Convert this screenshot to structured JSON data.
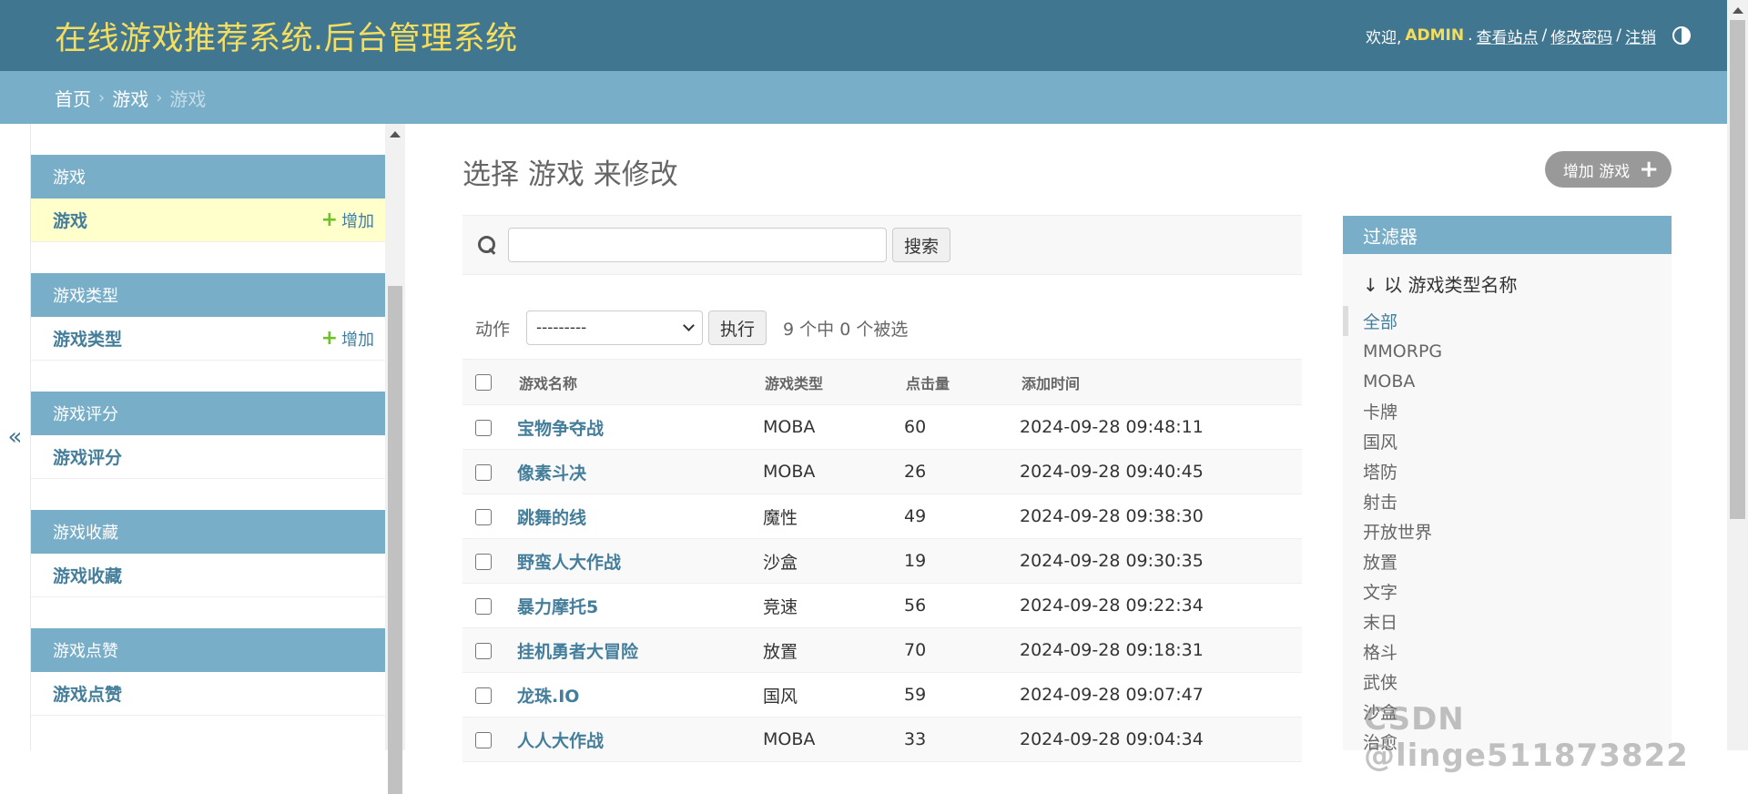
{
  "header": {
    "site_title": "在线游戏推荐系统.后台管理系统",
    "welcome": "欢迎,",
    "username": "ADMIN",
    "dot": ".",
    "view_site": "查看站点",
    "change_password": "修改密码",
    "logout": "注销",
    "slash": "/"
  },
  "breadcrumbs": {
    "home": "首页",
    "app": "游戏",
    "current": "游戏",
    "sep": "›"
  },
  "nav_toggle": "«",
  "sidebar": {
    "add_label": "增加",
    "groups": [
      {
        "caption": "游戏",
        "model": "游戏",
        "addable": true,
        "current": true
      },
      {
        "caption": "游戏类型",
        "model": "游戏类型",
        "addable": true
      },
      {
        "caption": "游戏评分",
        "model": "游戏评分"
      },
      {
        "caption": "游戏收藏",
        "model": "游戏收藏"
      },
      {
        "caption": "游戏点赞",
        "model": "游戏点赞"
      }
    ]
  },
  "content": {
    "title": "选择 游戏 来修改",
    "add_button": "增加 游戏",
    "search_button": "搜索",
    "search_value": "",
    "action_label": "动作",
    "action_selected": "---------",
    "go_button": "执行",
    "counter": "9 个中 0 个被选"
  },
  "table": {
    "columns": [
      "游戏名称",
      "游戏类型",
      "点击量",
      "添加时间"
    ],
    "rows": [
      [
        "宝物争夺战",
        "MOBA",
        "60",
        "2024-09-28 09:48:11"
      ],
      [
        "像素斗决",
        "MOBA",
        "26",
        "2024-09-28 09:40:45"
      ],
      [
        "跳舞的线",
        "魔性",
        "49",
        "2024-09-28 09:38:30"
      ],
      [
        "野蛮人大作战",
        "沙盒",
        "19",
        "2024-09-28 09:30:35"
      ],
      [
        "暴力摩托5",
        "竞速",
        "56",
        "2024-09-28 09:22:34"
      ],
      [
        "挂机勇者大冒险",
        "放置",
        "70",
        "2024-09-28 09:18:31"
      ],
      [
        "龙珠.IO",
        "国风",
        "59",
        "2024-09-28 09:07:47"
      ],
      [
        "人人大作战",
        "MOBA",
        "33",
        "2024-09-28 09:04:34"
      ]
    ]
  },
  "filter": {
    "title": "过滤器",
    "subtitle": "↓ 以 游戏类型名称",
    "options": [
      "全部",
      "MMORPG",
      "MOBA",
      "卡牌",
      "国风",
      "塔防",
      "射击",
      "开放世界",
      "放置",
      "文字",
      "末日",
      "格斗",
      "武侠",
      "沙盒",
      "治愈"
    ],
    "selected": "全部"
  },
  "watermark": "CSDN @linge511873822"
}
